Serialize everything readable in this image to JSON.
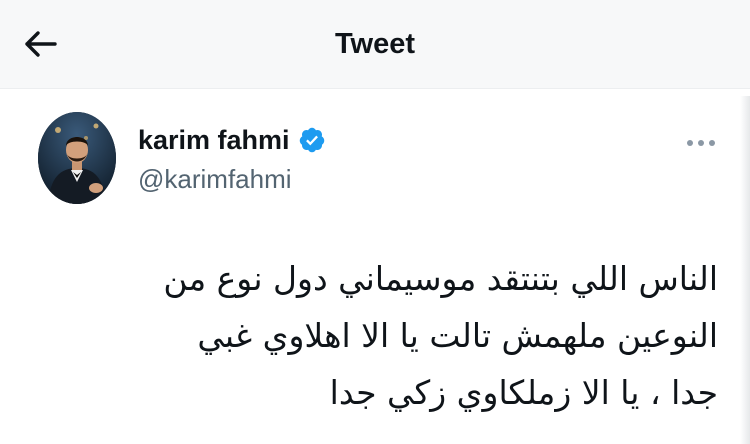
{
  "header": {
    "title": "Tweet",
    "back_icon": "arrow-left-icon"
  },
  "author": {
    "display_name": "karim fahmi",
    "handle": "@karimfahmi",
    "verified": true,
    "verified_icon": "verified-badge-icon",
    "verified_color": "#1d9bf0"
  },
  "more_icon": "more-horizontal-icon",
  "tweet": {
    "lines": [
      "الناس اللي بتنتقد موسيماني دول نوع من",
      "النوعين ملهمش تالت يا الا اهلاوي غبي",
      "جدا ، يا الا زملكاوي زكي جدا"
    ]
  },
  "colors": {
    "text": "#0f1419",
    "secondary": "#536471",
    "header_bg": "#f7f8f9"
  }
}
